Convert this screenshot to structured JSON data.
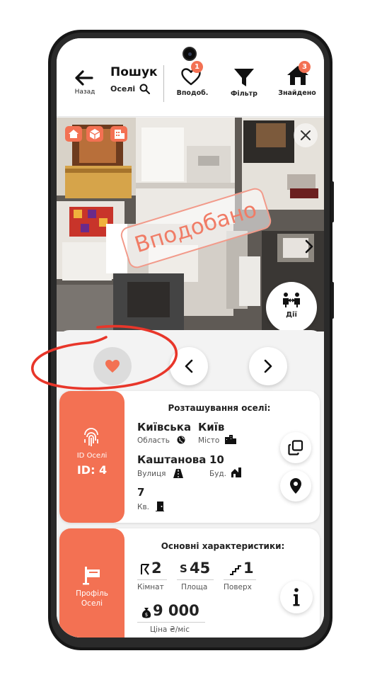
{
  "header": {
    "back_label": "Назад",
    "search_title": "Пошук",
    "search_sub": "Оселі",
    "liked_label": "Вподоб.",
    "liked_count": "1",
    "filter_label": "Фільтр",
    "found_label": "Знайдено",
    "found_count": "3"
  },
  "photo": {
    "stamp_text": "Вподобано",
    "actions_label": "Дії"
  },
  "location_card": {
    "id_label": "ID Оселі",
    "id_value": "ID: 4",
    "title": "Розташування оселі:",
    "region_value": "Київська",
    "region_label": "Область",
    "city_value": "Київ",
    "city_label": "Місто",
    "street_value": "Каштанова",
    "street_label": "Вулиця",
    "building_value": "10",
    "building_label": "Буд.",
    "apartment_value": "7",
    "apartment_label": "Кв."
  },
  "features_card": {
    "profile_label_1": "Профіль",
    "profile_label_2": "Оселі",
    "title": "Основні характеристики:",
    "rooms_value": "2",
    "rooms_label": "Кімнат",
    "area_value": "45",
    "area_label": "Площа",
    "floor_value": "1",
    "floor_label": "Поверх",
    "price_value": "9 000",
    "price_label": "Ціна ₴/міс"
  },
  "colors": {
    "accent": "#f37153",
    "annotation_red": "#e8362a"
  }
}
